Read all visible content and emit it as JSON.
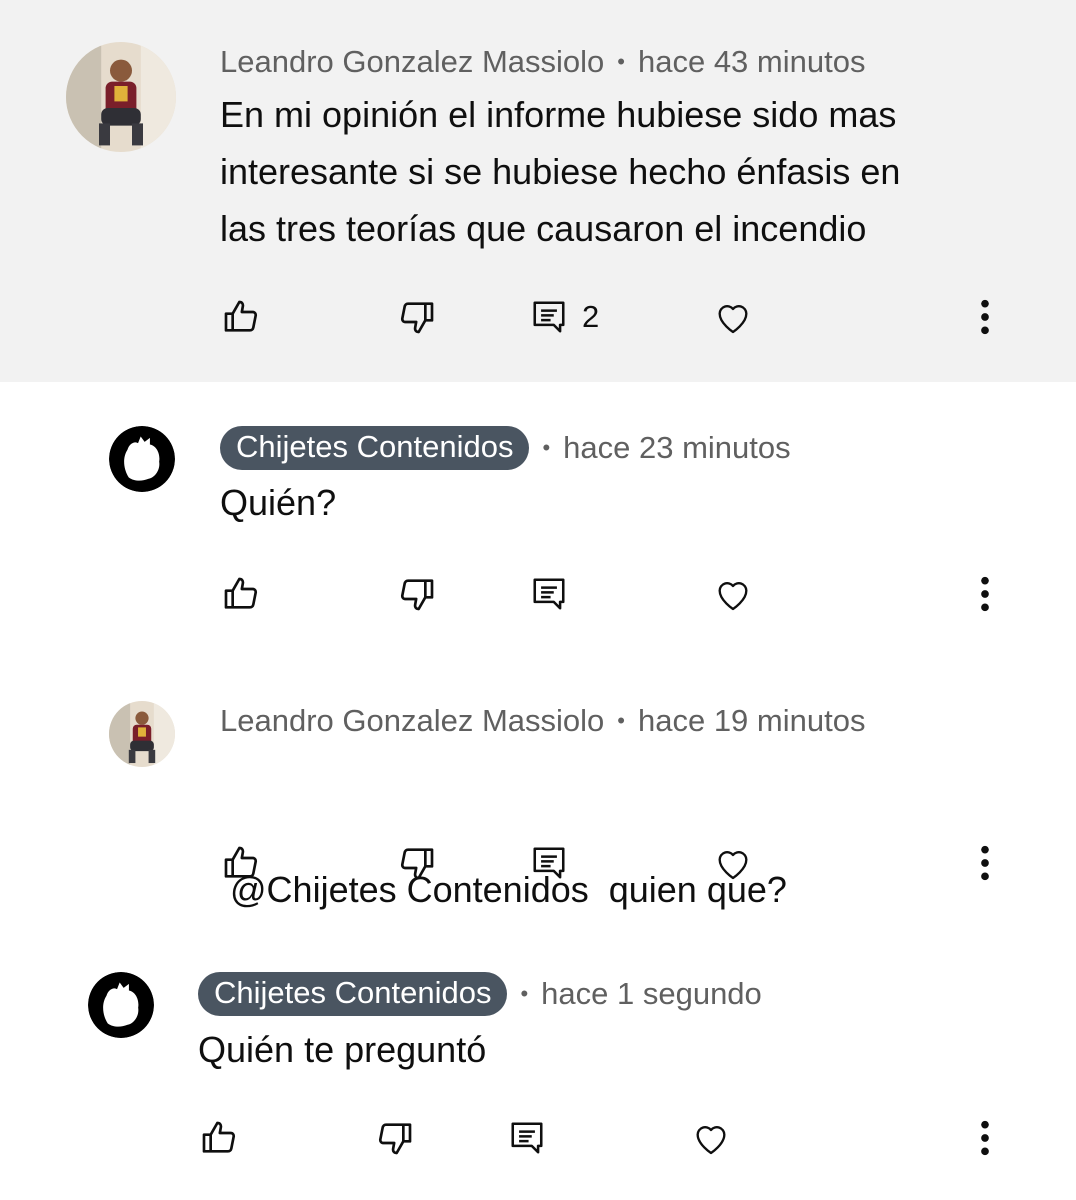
{
  "comments": [
    {
      "author": "Leandro Gonzalez Massiolo",
      "time": "hace 43 minutos",
      "lines": [
        "En mi opinión el informe hubiese sido mas",
        "interesante si se hubiese hecho énfasis en",
        "las tres teorías que causaron el incendio"
      ],
      "reply_count": "2",
      "highlighted": true,
      "author_badge": false
    },
    {
      "author": "Chijetes Contenidos",
      "time": "hace 23 minutos",
      "lines": [
        "Quién?"
      ],
      "author_badge": true
    },
    {
      "author": "Leandro Gonzalez Massiolo",
      "time": "hace 19 minutos",
      "lines": [
        " @Chijetes Contenidos  quien que?"
      ],
      "author_badge": false
    },
    {
      "author": "Chijetes Contenidos",
      "time": "hace 1 segundo",
      "lines": [
        "Quién te preguntó"
      ],
      "author_badge": true
    }
  ],
  "separator": "•",
  "icons": [
    "like-icon",
    "dislike-icon",
    "reply-icon",
    "heart-icon",
    "more-icon"
  ],
  "colors": {
    "highlight_bg": "#f2f2f2",
    "badge_bg": "#4a5561",
    "meta_text": "#606060",
    "text": "#0f0f0f"
  }
}
